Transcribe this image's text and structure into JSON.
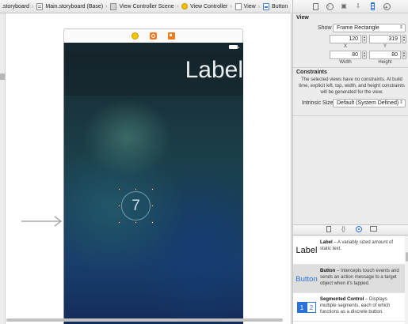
{
  "breadcrumbs": [
    {
      "label": ".storyboard",
      "icon": "none"
    },
    {
      "label": "Main.storyboard (Base)",
      "icon": "storyboard-file-icon"
    },
    {
      "label": "View Controller Scene",
      "icon": "scene-icon"
    },
    {
      "label": "View Controller",
      "icon": "view-controller-icon"
    },
    {
      "label": "View",
      "icon": "view-icon"
    },
    {
      "label": "Button",
      "icon": "button-icon"
    }
  ],
  "canvas": {
    "label_text": "Label",
    "button_title": "7",
    "dock_icons": [
      "view-controller-icon",
      "first-responder-icon",
      "exit-icon"
    ]
  },
  "inspector": {
    "tabs": [
      "file-icon",
      "help-icon",
      "identity-icon",
      "attributes-icon",
      "size-icon",
      "connections-icon"
    ],
    "active_tab": "size-icon",
    "view_section_title": "View",
    "show_label": "Show",
    "show_value": "Frame Rectangle",
    "x_value": "120",
    "y_value": "319",
    "x_label": "X",
    "y_label": "Y",
    "width_value": "80",
    "height_value": "80",
    "width_label": "Width",
    "height_label": "Height",
    "constraints_title": "Constraints",
    "constraints_text": "The selected views have no constraints. At build time, explicit left, top, width, and height constraints will be generated for the view.",
    "intrinsic_label": "Intrinsic Size",
    "intrinsic_value": "Default (System Defined)"
  },
  "library": {
    "tabs": [
      "file-template-icon",
      "code-snippet-icon",
      "object-library-icon",
      "media-library-icon"
    ],
    "active_tab": "object-library-icon",
    "items": [
      {
        "thumb": "Label",
        "name": "Label",
        "desc": " – A variably sized amount of static text."
      },
      {
        "thumb": "Button",
        "name": "Button",
        "desc": " – Intercepts touch events and sends an action message to a target object when it's tapped."
      },
      {
        "thumb_segments": [
          "1",
          "2"
        ],
        "name": "Segmented Control",
        "desc": " – Displays multiple segments, each of which functions as a discrete button."
      }
    ]
  },
  "colors": {
    "accent": "#2b73e6",
    "screen_dark": "#16262d",
    "screen_blue": "#183e6b"
  }
}
